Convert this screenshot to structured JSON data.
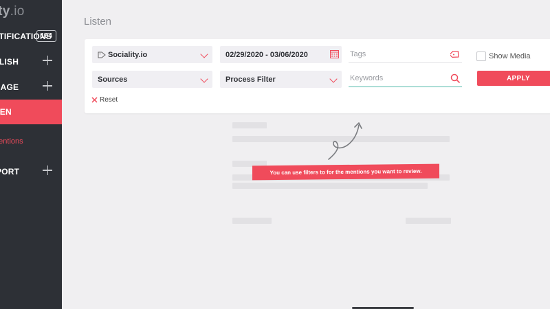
{
  "sidebar": {
    "logo": "Sociality.io",
    "logo_bold": "lity",
    "logo_rest": ".io",
    "items": [
      {
        "label": "NOTIFICATIONS",
        "badge": "164"
      },
      {
        "label": "PUBLISH"
      },
      {
        "label": "ENGAGE"
      },
      {
        "label": "LISTEN"
      },
      {
        "label": "REPORT"
      }
    ],
    "sub_item": "Mentions"
  },
  "page": {
    "title": "Listen"
  },
  "filters": {
    "account_select": "Sociality.io",
    "date_range": "02/29/2020 - 03/06/2020",
    "tags_placeholder": "Tags",
    "sources_select": "Sources",
    "process_select": "Process Filter",
    "keywords_placeholder": "Keywords",
    "show_media_label": "Show Media",
    "apply_label": "APPLY",
    "reset_label": "Reset"
  },
  "tooltip": {
    "text": "You can use filters to for the mentions you want to review."
  },
  "colors": {
    "accent": "#f04b5b",
    "sidebar_bg": "#2d3036",
    "focus": "#4fb9a8",
    "bg": "#f0eff1"
  }
}
